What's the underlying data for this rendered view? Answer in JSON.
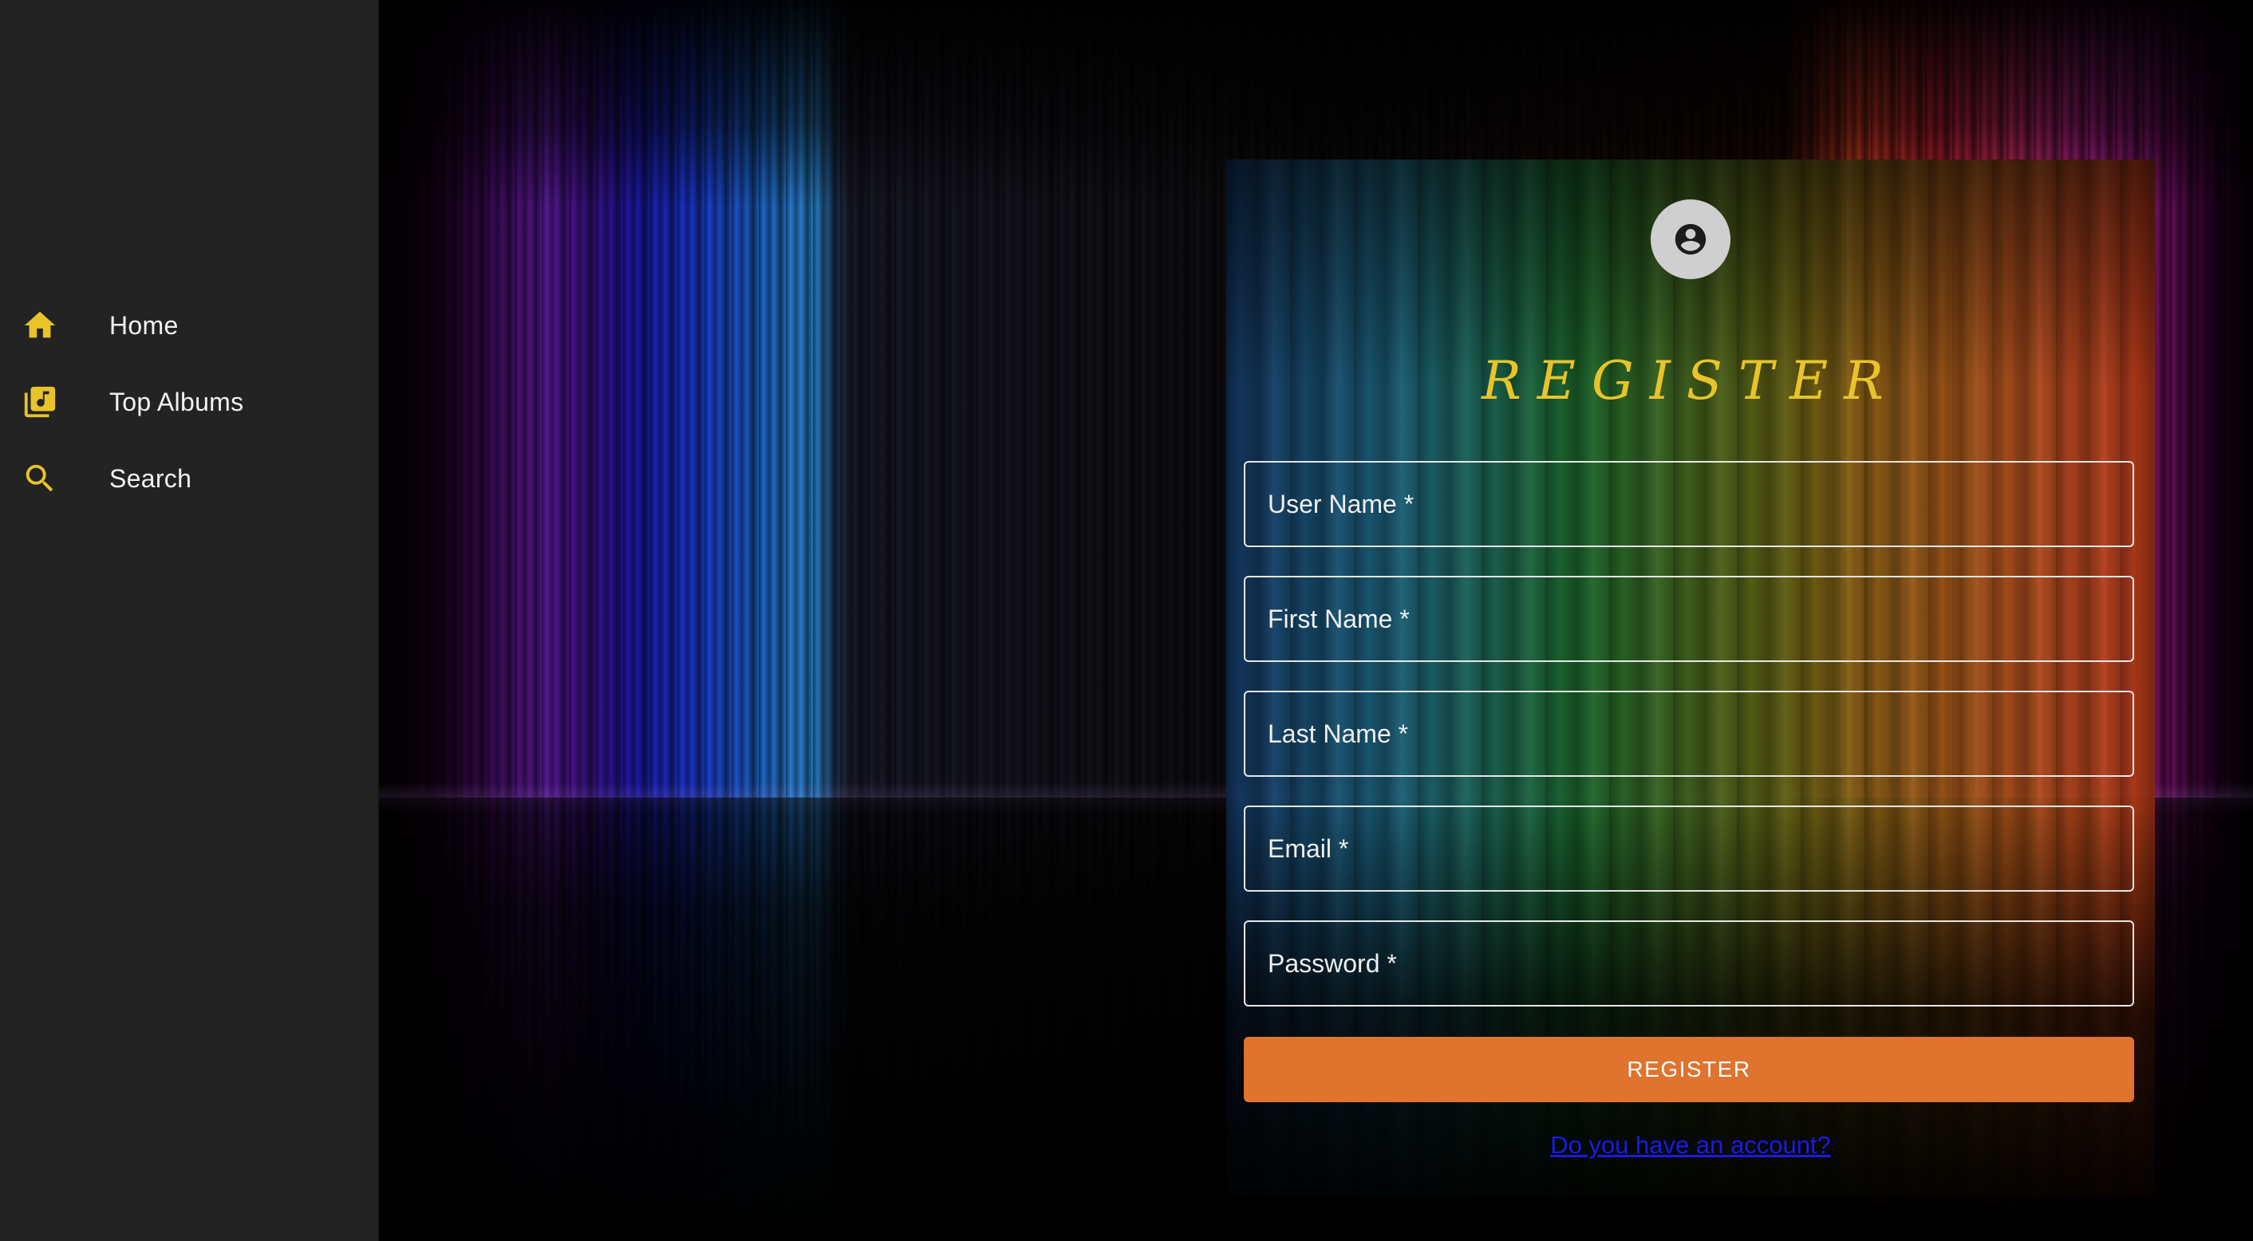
{
  "sidebar": {
    "items": [
      {
        "label": "Home",
        "icon": "home-icon"
      },
      {
        "label": "Top Albums",
        "icon": "library-music-icon"
      },
      {
        "label": "Search",
        "icon": "search-icon"
      }
    ]
  },
  "register": {
    "avatar_icon": "account-circle-icon",
    "title": "REGISTER",
    "fields": {
      "username": {
        "placeholder": "User Name *",
        "value": ""
      },
      "first_name": {
        "placeholder": "First Name *",
        "value": ""
      },
      "last_name": {
        "placeholder": "Last Name *",
        "value": ""
      },
      "email": {
        "placeholder": "Email *",
        "value": ""
      },
      "password": {
        "placeholder": "Password *",
        "value": ""
      }
    },
    "submit_label": "REGISTER",
    "login_link": "Do you have an account?"
  },
  "colors": {
    "sidebar_bg": "#232323",
    "icon_accent": "#e8c42a",
    "title": "#e8c42a",
    "button": "#e0732e",
    "link": "#1a1ae8"
  }
}
